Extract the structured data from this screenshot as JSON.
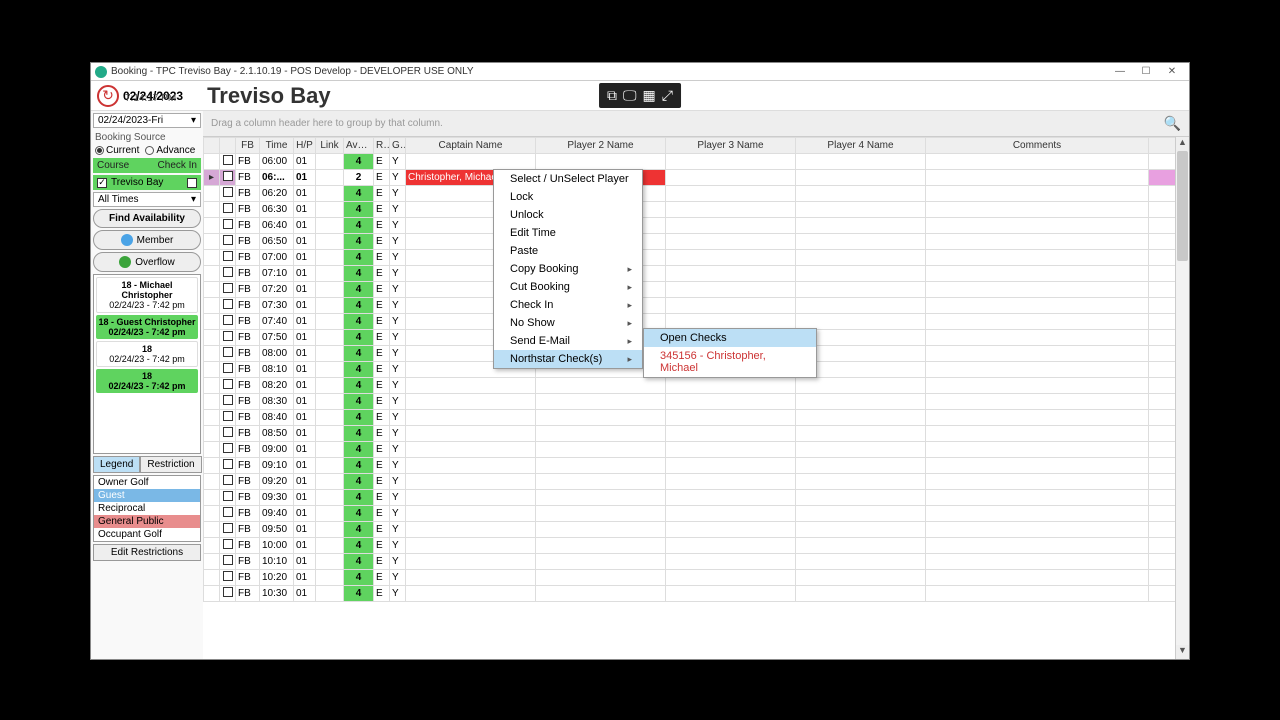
{
  "window": {
    "title": "Booking - TPC Treviso Bay - 2.1.10.19 - POS Develop - DEVELOPER USE ONLY"
  },
  "header": {
    "date": "02/24/2023",
    "clock": "7:14:17 PM",
    "club_name": "Treviso Bay",
    "groupbar_hint": "Drag a column header here to group by that column."
  },
  "sidebar": {
    "date_select": "02/24/2023-Fri",
    "booking_source_label": "Booking Source",
    "radio_current": "Current",
    "radio_advance": "Advance",
    "course_label": "Course",
    "checkin_label": "Check In",
    "treviso": "Treviso Bay",
    "all_times": "All Times",
    "find_availability": "Find Availability",
    "member": "Member",
    "overflow": "Overflow",
    "bookings": [
      {
        "title": "18 - Michael Christopher",
        "sub": "02/24/23 - 7:42 pm",
        "cls": "bk-white"
      },
      {
        "title": "18 - Guest Christopher",
        "sub": "02/24/23 - 7:42 pm",
        "cls": "bk-green"
      },
      {
        "title": "18",
        "sub": "02/24/23 - 7:42 pm",
        "cls": "bk-white"
      },
      {
        "title": "18",
        "sub": "02/24/23 - 7:42 pm",
        "cls": "bk-green"
      }
    ],
    "tabs": {
      "legend": "Legend",
      "restriction": "Restriction"
    },
    "legend_items": [
      "Owner Golf",
      "Guest",
      "Reciprocal",
      "General Public",
      "Occupant Golf"
    ],
    "edit_restrictions": "Edit Restrictions"
  },
  "columns": [
    "",
    "",
    "FB",
    "Time",
    "H/P",
    "Link",
    "Avail...",
    "R...",
    "G...",
    "Captain Name",
    "Player 2 Name",
    "Player 3 Name",
    "Player 4 Name",
    "Comments",
    ""
  ],
  "rows": [
    {
      "fb": "FB",
      "time": "06:00",
      "hp": "01",
      "avail": "4",
      "r": "E",
      "g": "Y"
    },
    {
      "fb": "FB",
      "time": "06:...",
      "hp": "01",
      "avail": "2",
      "r": "E",
      "g": "Y",
      "captain": "Christopher, Michael",
      "p2": "",
      "selected": true
    },
    {
      "fb": "FB",
      "time": "06:20",
      "hp": "01",
      "avail": "4",
      "r": "E",
      "g": "Y"
    },
    {
      "fb": "FB",
      "time": "06:30",
      "hp": "01",
      "avail": "4",
      "r": "E",
      "g": "Y"
    },
    {
      "fb": "FB",
      "time": "06:40",
      "hp": "01",
      "avail": "4",
      "r": "E",
      "g": "Y"
    },
    {
      "fb": "FB",
      "time": "06:50",
      "hp": "01",
      "avail": "4",
      "r": "E",
      "g": "Y"
    },
    {
      "fb": "FB",
      "time": "07:00",
      "hp": "01",
      "avail": "4",
      "r": "E",
      "g": "Y"
    },
    {
      "fb": "FB",
      "time": "07:10",
      "hp": "01",
      "avail": "4",
      "r": "E",
      "g": "Y"
    },
    {
      "fb": "FB",
      "time": "07:20",
      "hp": "01",
      "avail": "4",
      "r": "E",
      "g": "Y"
    },
    {
      "fb": "FB",
      "time": "07:30",
      "hp": "01",
      "avail": "4",
      "r": "E",
      "g": "Y"
    },
    {
      "fb": "FB",
      "time": "07:40",
      "hp": "01",
      "avail": "4",
      "r": "E",
      "g": "Y"
    },
    {
      "fb": "FB",
      "time": "07:50",
      "hp": "01",
      "avail": "4",
      "r": "E",
      "g": "Y"
    },
    {
      "fb": "FB",
      "time": "08:00",
      "hp": "01",
      "avail": "4",
      "r": "E",
      "g": "Y"
    },
    {
      "fb": "FB",
      "time": "08:10",
      "hp": "01",
      "avail": "4",
      "r": "E",
      "g": "Y"
    },
    {
      "fb": "FB",
      "time": "08:20",
      "hp": "01",
      "avail": "4",
      "r": "E",
      "g": "Y"
    },
    {
      "fb": "FB",
      "time": "08:30",
      "hp": "01",
      "avail": "4",
      "r": "E",
      "g": "Y"
    },
    {
      "fb": "FB",
      "time": "08:40",
      "hp": "01",
      "avail": "4",
      "r": "E",
      "g": "Y"
    },
    {
      "fb": "FB",
      "time": "08:50",
      "hp": "01",
      "avail": "4",
      "r": "E",
      "g": "Y"
    },
    {
      "fb": "FB",
      "time": "09:00",
      "hp": "01",
      "avail": "4",
      "r": "E",
      "g": "Y"
    },
    {
      "fb": "FB",
      "time": "09:10",
      "hp": "01",
      "avail": "4",
      "r": "E",
      "g": "Y"
    },
    {
      "fb": "FB",
      "time": "09:20",
      "hp": "01",
      "avail": "4",
      "r": "E",
      "g": "Y"
    },
    {
      "fb": "FB",
      "time": "09:30",
      "hp": "01",
      "avail": "4",
      "r": "E",
      "g": "Y"
    },
    {
      "fb": "FB",
      "time": "09:40",
      "hp": "01",
      "avail": "4",
      "r": "E",
      "g": "Y"
    },
    {
      "fb": "FB",
      "time": "09:50",
      "hp": "01",
      "avail": "4",
      "r": "E",
      "g": "Y"
    },
    {
      "fb": "FB",
      "time": "10:00",
      "hp": "01",
      "avail": "4",
      "r": "E",
      "g": "Y"
    },
    {
      "fb": "FB",
      "time": "10:10",
      "hp": "01",
      "avail": "4",
      "r": "E",
      "g": "Y"
    },
    {
      "fb": "FB",
      "time": "10:20",
      "hp": "01",
      "avail": "4",
      "r": "E",
      "g": "Y"
    },
    {
      "fb": "FB",
      "time": "10:30",
      "hp": "01",
      "avail": "4",
      "r": "E",
      "g": "Y"
    }
  ],
  "context_menu": {
    "items": [
      {
        "label": "Select / UnSelect Player"
      },
      {
        "label": "Lock"
      },
      {
        "label": "Unlock"
      },
      {
        "label": "Edit Time"
      },
      {
        "label": "Paste"
      },
      {
        "label": "Copy Booking",
        "sub": true
      },
      {
        "label": "Cut Booking",
        "sub": true
      },
      {
        "label": "Check In",
        "sub": true
      },
      {
        "label": "No Show",
        "sub": true
      },
      {
        "label": "Send E-Mail",
        "sub": true
      },
      {
        "label": "Northstar Check(s)",
        "sub": true,
        "hl": true
      }
    ]
  },
  "submenu": {
    "open_checks": "Open Checks",
    "check_line": "345156 - Christopher, Michael"
  }
}
